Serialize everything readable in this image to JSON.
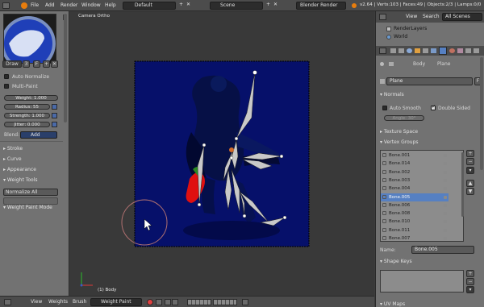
{
  "menu": {
    "file": "File",
    "add": "Add",
    "render": "Render",
    "window": "Window",
    "help": "Help"
  },
  "header": {
    "layout": "Default",
    "scene": "Scene",
    "engine": "Blender Render",
    "stats": "v2.64 | Verts:103 | Faces:49 | Objects:2/3 | Lamps:0/0"
  },
  "toolshelf": {
    "brush_name": "Draw",
    "users": "3",
    "fake_user": "F",
    "auto_normalize": "Auto Normalize",
    "multi_paint": "Multi-Paint",
    "weight": "Weight: 1.000",
    "radius": "Radius: 55",
    "strength": "Strength: 1.000",
    "jitter": "Jitter: 0.000",
    "blend_label": "Blend:",
    "blend_value": "Add",
    "stroke": "Stroke",
    "curve": "Curve",
    "appearance": "Appearance",
    "weight_tools": "Weight Tools",
    "normalize_all": "Normalize All",
    "weight_paint_mode": "Weight Paint Mode"
  },
  "viewport": {
    "view_name": "Camera Ortho",
    "object_label": "(1) Body"
  },
  "bottom": {
    "view": "View",
    "weights": "Weights",
    "brush": "Brush",
    "mode": "Weight Paint"
  },
  "outliner": {
    "view": "View",
    "search": "Search",
    "scenes": "All Scenes",
    "items": [
      "RenderLayers",
      "World"
    ]
  },
  "properties": {
    "crumb_body": "Body",
    "crumb_plane": "Plane",
    "data_name": "Plane",
    "data_f": "F",
    "normals": "Normals",
    "auto_smooth": "Auto Smooth",
    "double_sided": "Double Sided",
    "angle": "Angle: 30°",
    "texture_space": "Texture Space",
    "vertex_groups": "Vertex Groups",
    "groups": [
      "Bone.001",
      "Bone.014",
      "Bone.002",
      "Bone.003",
      "Bone.004",
      "Bone.005",
      "Bone.006",
      "Bone.008",
      "Bone.010",
      "Bone.011",
      "Bone.007"
    ],
    "active_group": "Bone.005",
    "name_label": "Name:",
    "name_value": "Bone.005",
    "shape_keys": "Shape Keys",
    "uv_maps": "UV Maps"
  },
  "colors": {
    "selection": "#5680c2",
    "canvas": "#06106a",
    "panel": "#727272"
  }
}
